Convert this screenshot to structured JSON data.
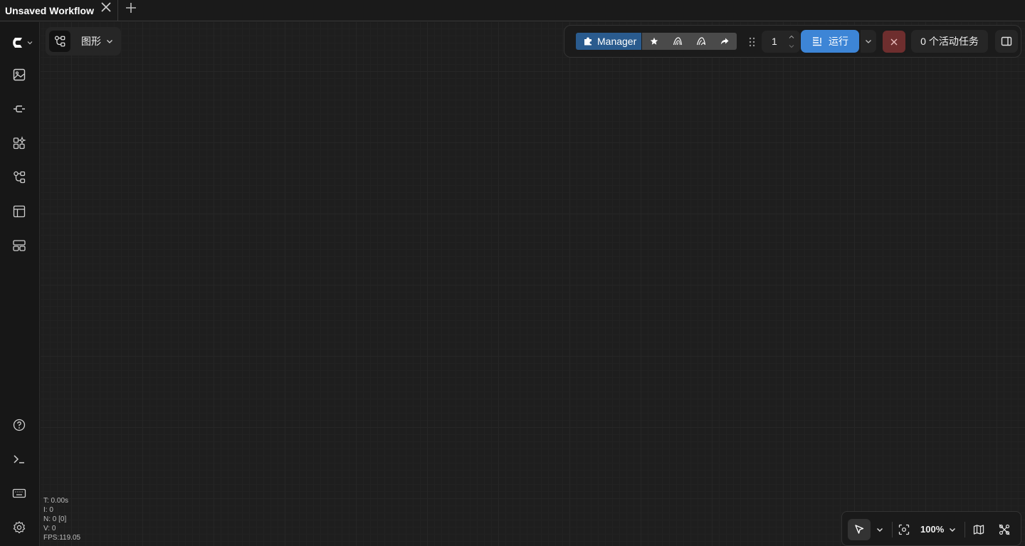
{
  "tab": {
    "title": "Unsaved Workflow"
  },
  "graph_menu": {
    "label": "图形"
  },
  "toolbar": {
    "manager_label": "Manager",
    "batch_count": "1",
    "run_label": "运行",
    "tasks_label": "0 个活动任务"
  },
  "stats": {
    "t": "T: 0.00s",
    "i": "I: 0",
    "n": "N: 0 [0]",
    "v": "V: 0",
    "fps": "FPS:119.05"
  },
  "zoom": {
    "label": "100%"
  },
  "colors": {
    "run": "#3d85d6",
    "manager": "#2a5b8e",
    "stop": "#6e2e2e"
  }
}
